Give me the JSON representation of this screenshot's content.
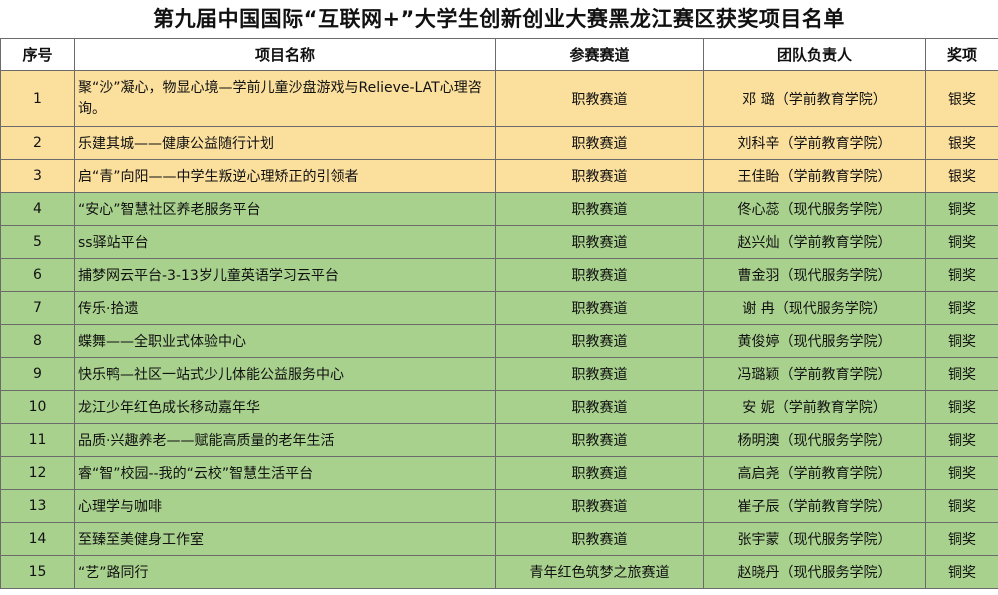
{
  "title": "第九届中国国际“互联网+”大学生创新创业大赛黑龙江赛区获奖项目名单",
  "headers": [
    "序号",
    "项目名称",
    "参赛赛道",
    "团队负责人",
    "奖项"
  ],
  "rows": [
    {
      "no": "1",
      "project": "聚“沙”凝心，物显心境—学前儿童沙盘游戏与Relieve-LAT心理咨询。",
      "track": "职教赛道",
      "leader": "邓  璐（学前教育学院）",
      "award": "银奖"
    },
    {
      "no": "2",
      "project": "乐建其城——健康公益随行计划",
      "track": "职教赛道",
      "leader": "刘科辛（学前教育学院）",
      "award": "银奖"
    },
    {
      "no": "3",
      "project": "启“青”向阳——中学生叛逆心理矫正的引领者",
      "track": "职教赛道",
      "leader": "王佳眙（学前教育学院）",
      "award": "银奖"
    },
    {
      "no": "4",
      "project": "“安心”智慧社区养老服务平台",
      "track": "职教赛道",
      "leader": "佟心蕊（现代服务学院）",
      "award": "铜奖"
    },
    {
      "no": "5",
      "project": "ss驿站平台",
      "track": "职教赛道",
      "leader": "赵兴灿（学前教育学院）",
      "award": "铜奖"
    },
    {
      "no": "6",
      "project": "捕梦网云平台-3-13岁儿童英语学习云平台",
      "track": "职教赛道",
      "leader": "曹金羽（现代服务学院）",
      "award": "铜奖"
    },
    {
      "no": "7",
      "project": "传乐·拾遗",
      "track": "职教赛道",
      "leader": "谢  冉（现代服务学院）",
      "award": "铜奖"
    },
    {
      "no": "8",
      "project": "蝶舞——全职业式体验中心",
      "track": "职教赛道",
      "leader": "黄俊婷（现代服务学院）",
      "award": "铜奖"
    },
    {
      "no": "9",
      "project": "快乐鸭—社区一站式少儿体能公益服务中心",
      "track": "职教赛道",
      "leader": "冯璐颖（学前教育学院）",
      "award": "铜奖"
    },
    {
      "no": "10",
      "project": "龙江少年红色成长移动嘉年华",
      "track": "职教赛道",
      "leader": "安  妮（学前教育学院）",
      "award": "铜奖"
    },
    {
      "no": "11",
      "project": "品质·兴趣养老——赋能高质量的老年生活",
      "track": "职教赛道",
      "leader": "杨明澳（现代服务学院）",
      "award": "铜奖"
    },
    {
      "no": "12",
      "project": "睿“智”校园--我的“云校”智慧生活平台",
      "track": "职教赛道",
      "leader": "高启尧（学前教育学院）",
      "award": "铜奖"
    },
    {
      "no": "13",
      "project": "心理学与咖啡",
      "track": "职教赛道",
      "leader": "崔子辰（学前教育学院）",
      "award": "铜奖"
    },
    {
      "no": "14",
      "project": "至臻至美健身工作室",
      "track": "职教赛道",
      "leader": "张宇蒙（现代服务学院）",
      "award": "铜奖"
    },
    {
      "no": "15",
      "project": "“艺”路同行",
      "track": "青年红色筑梦之旅赛道",
      "leader": "赵晓丹（现代服务学院）",
      "award": "铜奖"
    }
  ],
  "colors": {
    "silver_row": "#fbdf9d",
    "bronze_row": "#a9d18e",
    "border": "#6b6b6b"
  }
}
